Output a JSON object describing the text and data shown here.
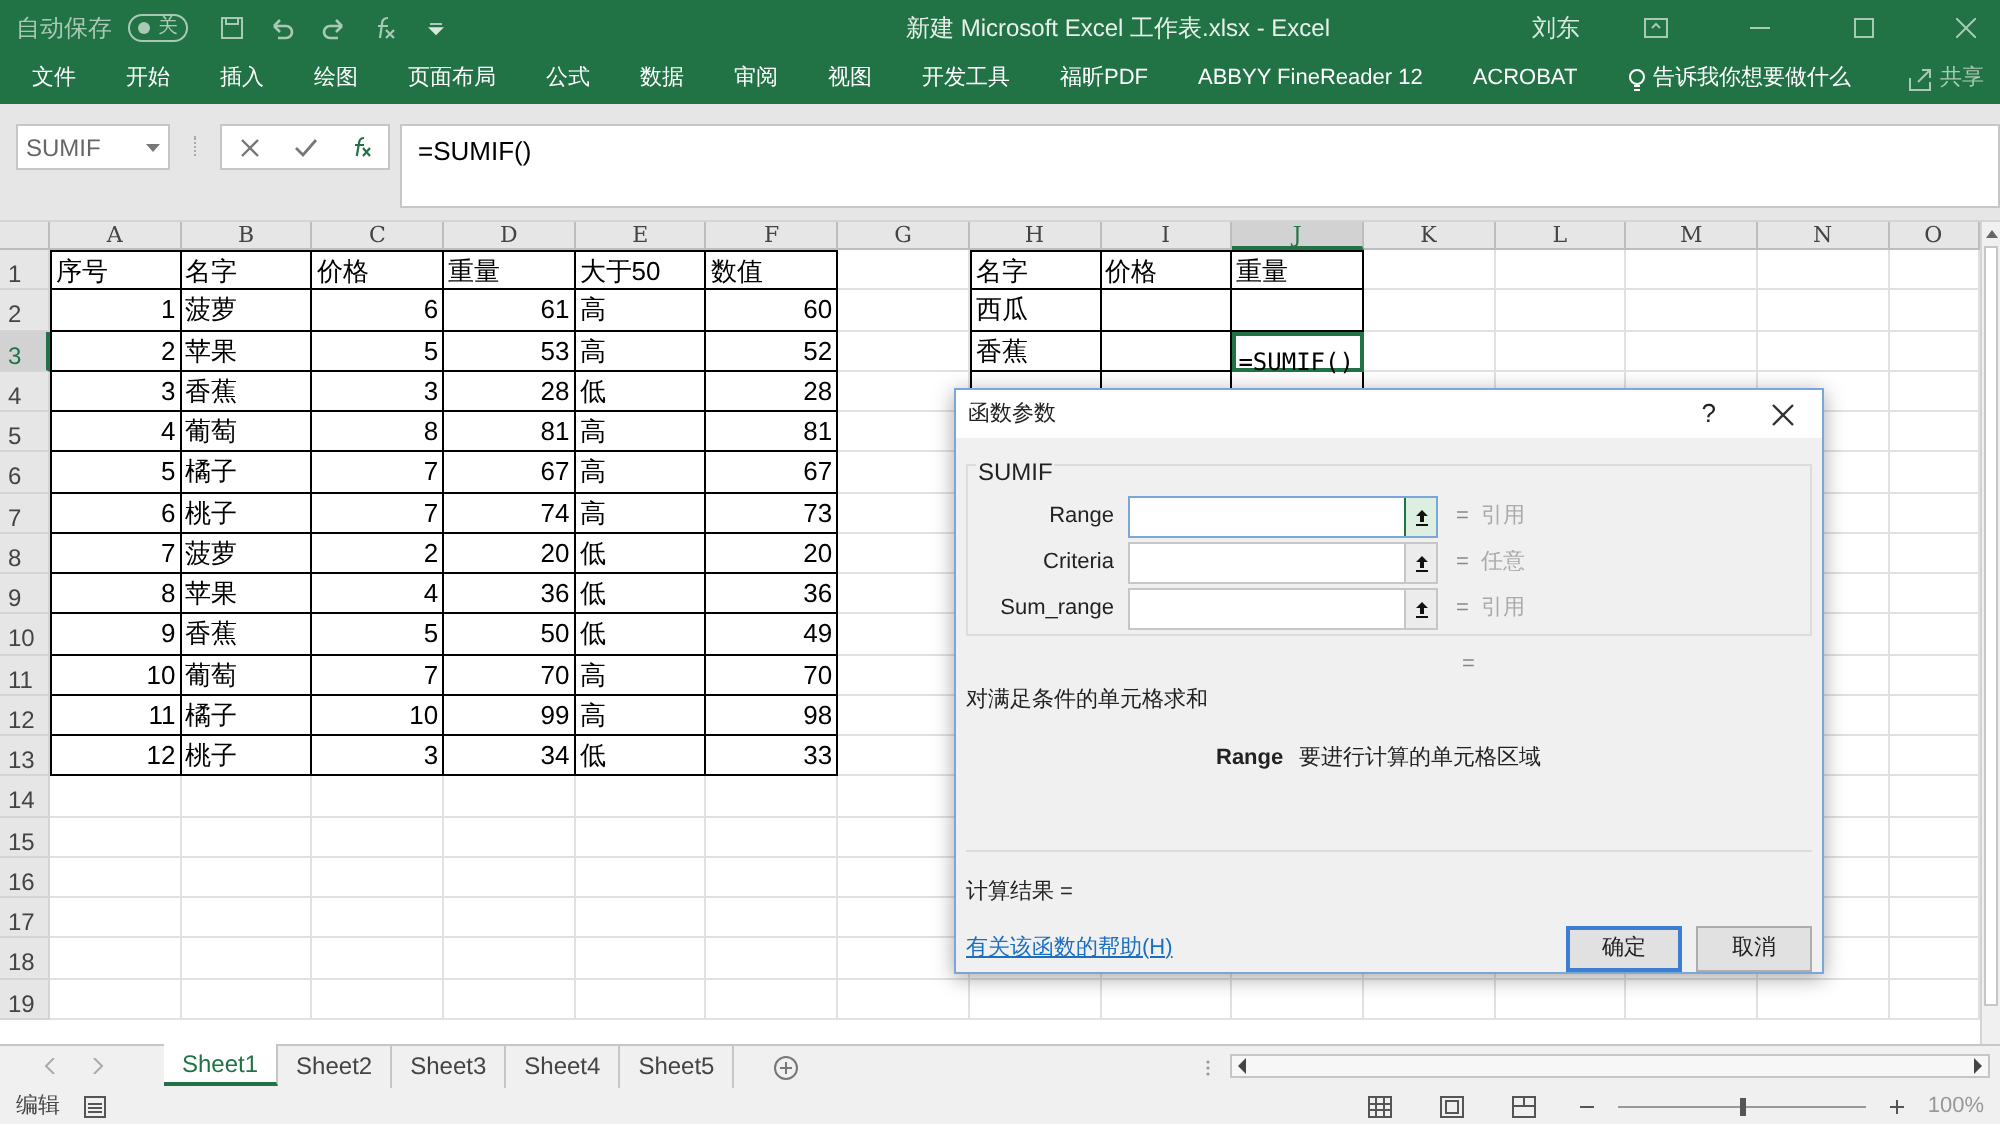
{
  "title_bar": {
    "autosave_label": "自动保存",
    "autosave_toggle": {
      "label": "关",
      "on": false
    },
    "title": "新建 Microsoft Excel 工作表.xlsx  -  Excel",
    "user": "刘东"
  },
  "ribbon": {
    "tabs": [
      {
        "label": "文件"
      },
      {
        "label": "开始"
      },
      {
        "label": "插入"
      },
      {
        "label": "绘图"
      },
      {
        "label": "页面布局"
      },
      {
        "label": "公式"
      },
      {
        "label": "数据"
      },
      {
        "label": "审阅"
      },
      {
        "label": "视图"
      },
      {
        "label": "开发工具"
      },
      {
        "label": "福昕PDF"
      },
      {
        "label": "ABBYY FineReader 12"
      },
      {
        "label": "ACROBAT"
      }
    ],
    "tell_me": "告诉我你想要做什么",
    "share": "共享"
  },
  "formula_bar": {
    "name_box": "SUMIF",
    "formula": "=SUMIF()"
  },
  "sheet": {
    "column_headers": [
      {
        "label": "A",
        "selected": false
      },
      {
        "label": "B",
        "selected": false
      },
      {
        "label": "C",
        "selected": false
      },
      {
        "label": "D",
        "selected": false
      },
      {
        "label": "E",
        "selected": false
      },
      {
        "label": "F",
        "selected": false
      },
      {
        "label": "G",
        "selected": false
      },
      {
        "label": "H",
        "selected": false
      },
      {
        "label": "I",
        "selected": false
      },
      {
        "label": "J",
        "selected": true
      },
      {
        "label": "K",
        "selected": false
      },
      {
        "label": "L",
        "selected": false
      },
      {
        "label": "M",
        "selected": false
      },
      {
        "label": "N",
        "selected": false
      },
      {
        "label": "O",
        "selected": false
      }
    ],
    "row_headers": [
      {
        "label": "1",
        "selected": false
      },
      {
        "label": "2",
        "selected": false
      },
      {
        "label": "3",
        "selected": true
      },
      {
        "label": "4",
        "selected": false
      },
      {
        "label": "5",
        "selected": false
      },
      {
        "label": "6",
        "selected": false
      },
      {
        "label": "7",
        "selected": false
      },
      {
        "label": "8",
        "selected": false
      },
      {
        "label": "9",
        "selected": false
      },
      {
        "label": "10",
        "selected": false
      },
      {
        "label": "11",
        "selected": false
      },
      {
        "label": "12",
        "selected": false
      },
      {
        "label": "13",
        "selected": false
      },
      {
        "label": "14",
        "selected": false
      },
      {
        "label": "15",
        "selected": false
      },
      {
        "label": "16",
        "selected": false
      },
      {
        "label": "17",
        "selected": false
      },
      {
        "label": "18",
        "selected": false
      },
      {
        "label": "19",
        "selected": false
      }
    ],
    "left_table": {
      "columns": [
        {
          "heading": "序号",
          "numeric": true
        },
        {
          "heading": "名字",
          "numeric": false
        },
        {
          "heading": "价格",
          "numeric": true
        },
        {
          "heading": "重量",
          "numeric": true
        },
        {
          "heading": "大于50",
          "numeric": false
        },
        {
          "heading": "数值",
          "numeric": true
        }
      ],
      "rows": [
        {
          "cells": [
            "1",
            "菠萝",
            "6",
            "61",
            "高",
            "60"
          ]
        },
        {
          "cells": [
            "2",
            "苹果",
            "5",
            "53",
            "高",
            "52"
          ]
        },
        {
          "cells": [
            "3",
            "香蕉",
            "3",
            "28",
            "低",
            "28"
          ]
        },
        {
          "cells": [
            "4",
            "葡萄",
            "8",
            "81",
            "高",
            "81"
          ]
        },
        {
          "cells": [
            "5",
            "橘子",
            "7",
            "67",
            "高",
            "67"
          ]
        },
        {
          "cells": [
            "6",
            "桃子",
            "7",
            "74",
            "高",
            "73"
          ]
        },
        {
          "cells": [
            "7",
            "菠萝",
            "2",
            "20",
            "低",
            "20"
          ]
        },
        {
          "cells": [
            "8",
            "苹果",
            "4",
            "36",
            "低",
            "36"
          ]
        },
        {
          "cells": [
            "9",
            "香蕉",
            "5",
            "50",
            "低",
            "49"
          ]
        },
        {
          "cells": [
            "10",
            "葡萄",
            "7",
            "70",
            "高",
            "70"
          ]
        },
        {
          "cells": [
            "11",
            "橘子",
            "10",
            "99",
            "高",
            "98"
          ]
        },
        {
          "cells": [
            "12",
            "桃子",
            "3",
            "34",
            "低",
            "33"
          ]
        }
      ]
    },
    "right_table": {
      "rows": [
        {
          "cells": [
            {
              "text": "名字",
              "selected": false
            },
            {
              "text": "价格",
              "selected": false
            },
            {
              "text": "重量",
              "selected": false
            }
          ]
        },
        {
          "cells": [
            {
              "text": "西瓜",
              "selected": false
            },
            {
              "selected": false
            },
            {
              "selected": false
            }
          ]
        },
        {
          "cells": [
            {
              "text": "香蕉",
              "selected": false
            },
            {
              "selected": false
            },
            {
              "text": "=SUMIF()",
              "selected": true
            }
          ]
        }
      ]
    },
    "sheet_tabs": [
      {
        "label": "Sheet1",
        "selected": true
      },
      {
        "label": "Sheet2",
        "selected": false
      },
      {
        "label": "Sheet3",
        "selected": false
      },
      {
        "label": "Sheet4",
        "selected": false
      },
      {
        "label": "Sheet5",
        "selected": false
      }
    ]
  },
  "dialog": {
    "title": "函数参数",
    "help": "?",
    "function_name": "SUMIF",
    "arguments": [
      {
        "label": "Range",
        "value_hint": "引用",
        "focused": true
      },
      {
        "label": "Criteria",
        "value_hint": "任意",
        "focused": false
      },
      {
        "label": "Sum_range",
        "value_hint": "引用",
        "focused": false
      }
    ],
    "equals": "=",
    "result_equals": "=",
    "description": "对满足条件的单元格求和",
    "argument_name": "Range",
    "argument_help": "要进行计算的单元格区域",
    "result_label": "计算结果 =",
    "help_link": "有关该函数的帮助(H)",
    "ok": "确定",
    "cancel": "取消"
  },
  "status_bar": {
    "mode": "编辑",
    "zoom": {
      "level": 0.5
    },
    "zoom_label": "100%"
  }
}
